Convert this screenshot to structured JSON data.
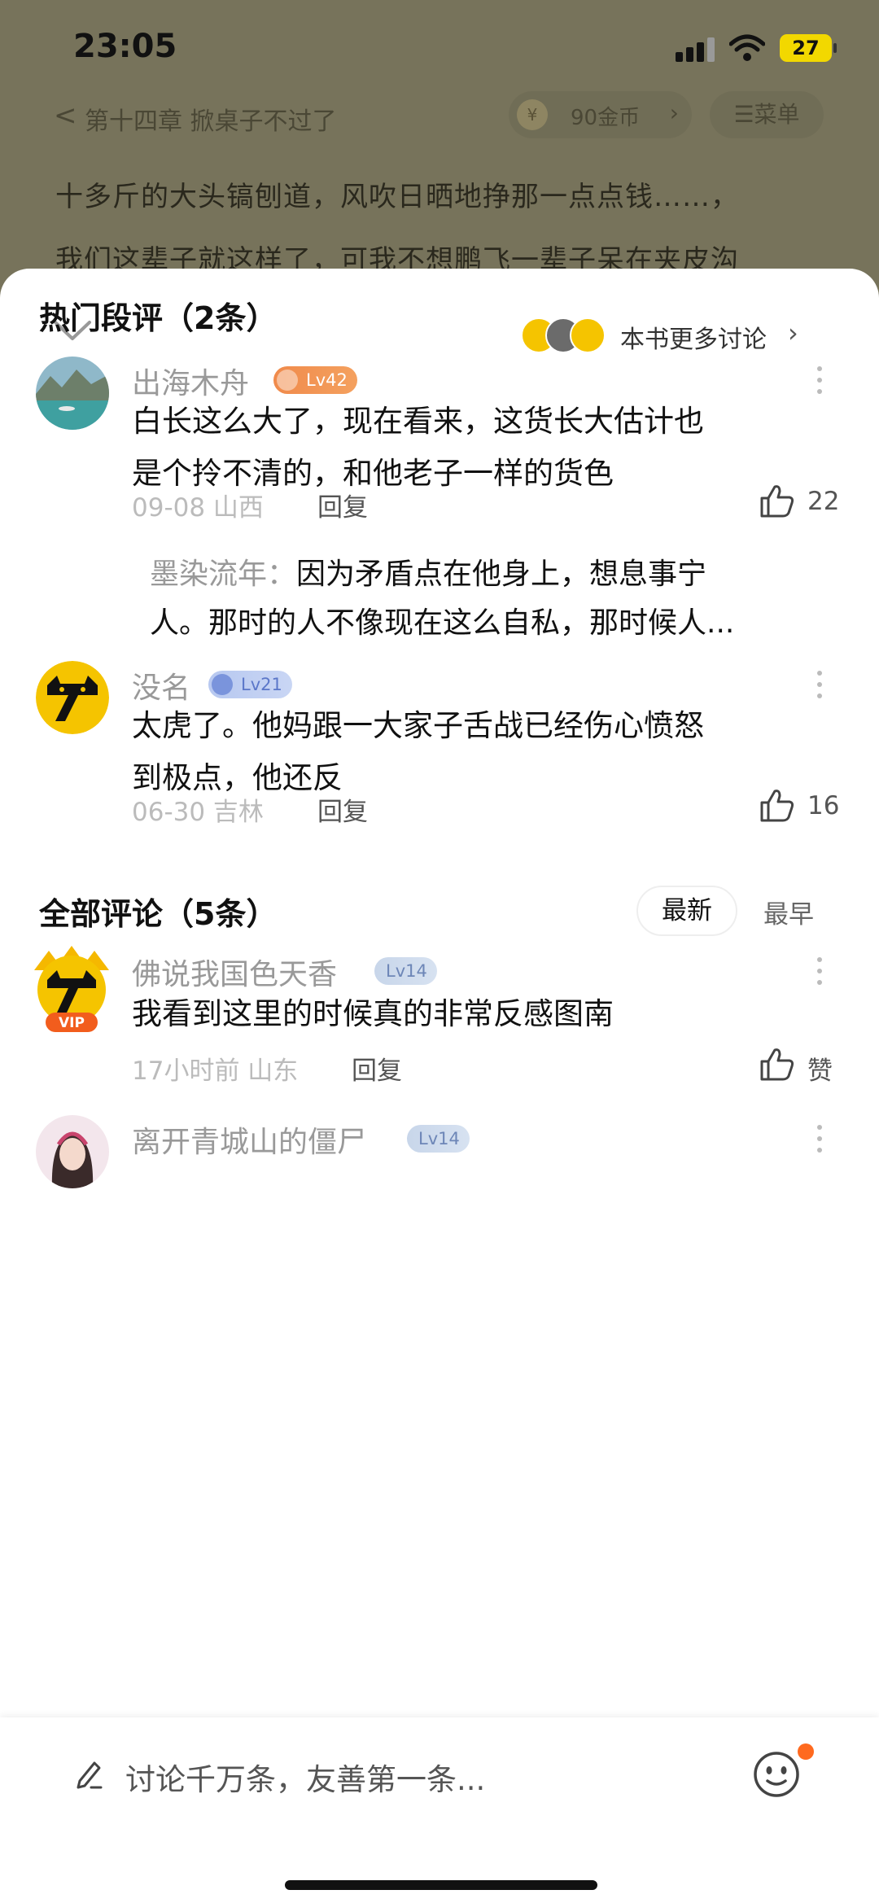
{
  "status_bar": {
    "time": "23:05",
    "battery": "27"
  },
  "reader": {
    "chapter_title": "第十四章  掀桌子不过了",
    "coins": "90金币",
    "menu_label": "☰菜单",
    "lines": [
      "十多斤的大头镐刨道，风吹日晒地挣那一点点钱……，",
      "我们这辈子就这样了，可我不想鹏飞一辈子呆在夹皮沟"
    ]
  },
  "sheet": {
    "more_discussion": "本书更多讨论",
    "hot_title": "热门段评（2条）",
    "all_title": "全部评论（5条）",
    "sort": {
      "newest": "最新",
      "earliest": "最早"
    },
    "reply_label": "回复"
  },
  "hot_comments": [
    {
      "user": "出海木舟",
      "level": "Lv42",
      "text": [
        "白长这么大了，现在看来，这货长大估计也",
        "是个拎不清的，和他老子一样的货色"
      ],
      "date": "09-08 山西",
      "likes": "22",
      "sub_reply": {
        "user": "墨染流年：",
        "text_1": "因为矛盾点在他身上，想息事宁",
        "text_2": "人。那时的人不像现在这么自私，那时候人..."
      }
    },
    {
      "user": "没名",
      "level": "Lv21",
      "text": [
        "太虎了。他妈跟一大家子舌战已经伤心愤怒",
        "到极点，他还反"
      ],
      "date": "06-30 吉林",
      "likes": "16"
    }
  ],
  "all_comments": [
    {
      "user": "佛说我国色天香",
      "level": "Lv14",
      "vip": "VIP",
      "text": "我看到这里的时候真的非常反感图南",
      "date": "17小时前 山东",
      "likes": "赞"
    },
    {
      "user": "离开青城山的僵尸",
      "level": "Lv14"
    }
  ],
  "input": {
    "placeholder": "讨论千万条，友善第一条..."
  },
  "colors": {
    "accent_orange": "#ff6a1f",
    "level_orange": "#f08a4b",
    "meta_gray": "#bbbbbb"
  }
}
